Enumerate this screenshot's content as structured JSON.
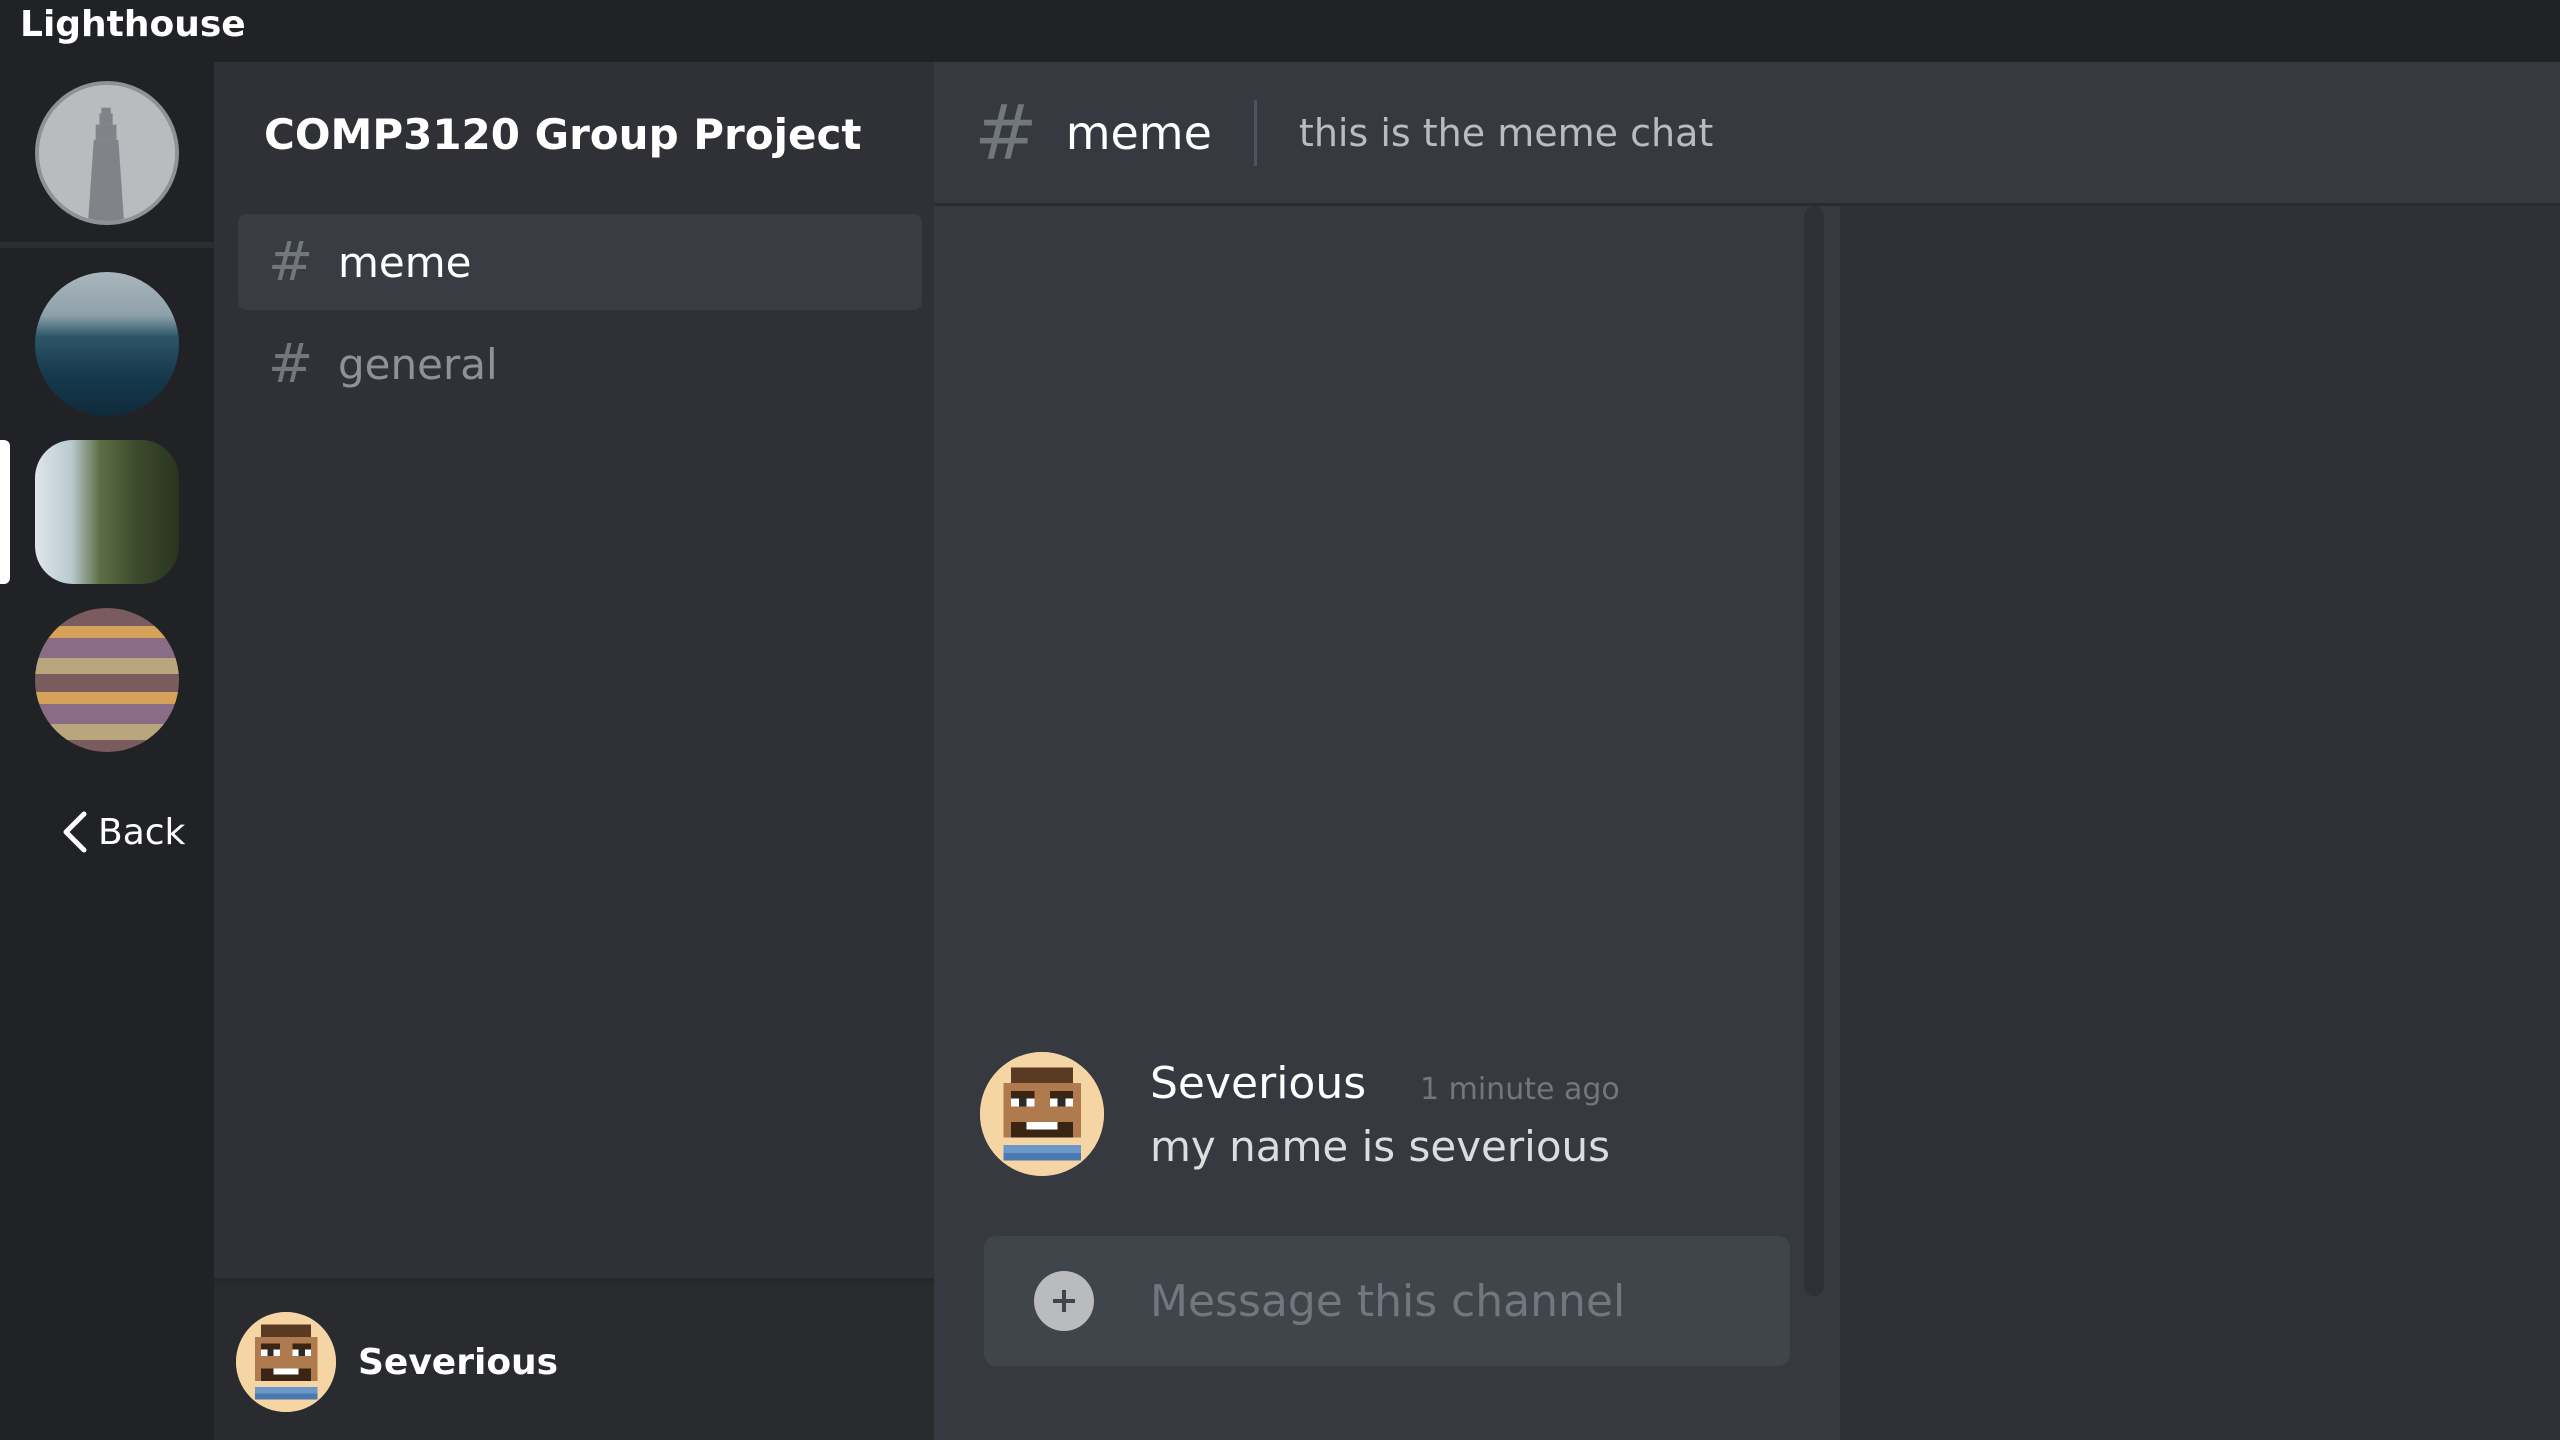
{
  "app": {
    "title": "Lighthouse"
  },
  "servers": [
    {
      "name": "lighthouse-home-icon"
    },
    {
      "name": "ocean-server-icon"
    },
    {
      "name": "cliff-road-server-icon",
      "active": true
    },
    {
      "name": "striped-server-icon"
    }
  ],
  "rail": {
    "back_label": "Back"
  },
  "guild": {
    "name": "COMP3120 Group Project"
  },
  "channels": [
    {
      "label": "meme",
      "selected": true
    },
    {
      "label": "general",
      "selected": false
    }
  ],
  "user": {
    "name": "Severious"
  },
  "chat": {
    "channel": "meme",
    "topic": "this is the meme chat",
    "messages": [
      {
        "author": "Severious",
        "time": "1 minute ago",
        "text": "my name is severious"
      }
    ],
    "composer_placeholder": "Message this channel"
  },
  "colors": {
    "background": "#202225",
    "sidebar": "#2f3136",
    "chat": "#36393f",
    "input": "#40444b",
    "text": "#dcddde",
    "muted": "#72767d"
  }
}
